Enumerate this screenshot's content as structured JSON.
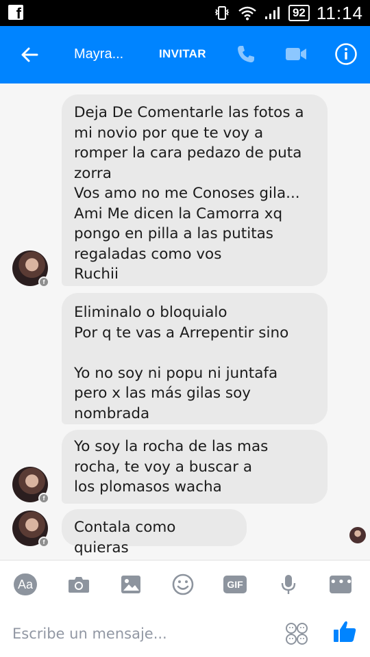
{
  "status_bar": {
    "battery": "92",
    "time": "11:14",
    "icons": [
      "facebook-app-icon",
      "vibrate-icon",
      "wifi-icon",
      "signal-icon",
      "battery-icon"
    ]
  },
  "header": {
    "contact_name": "Mayra...",
    "invite_label": "INVITAR",
    "icons": [
      "back-arrow-icon",
      "phone-icon",
      "video-icon",
      "info-icon"
    ]
  },
  "messages": [
    {
      "text": "Deja De Comentarle  las fotos a\nmi novio por que te voy a\nromper la cara pedazo de puta\nzorra\nVos amo no me Conoses gila...\nAmi Me dicen la Camorra xq\npongo en pilla a las putitas\nregaladas como vos\nRuchii"
    },
    {
      "text": "Eliminalo o bloquialo\nPor q te vas a Arrepentir sino\n\nYo no soy ni popu ni juntafa\npero x las más gilas soy\nnombrada"
    },
    {
      "text": "Yo soy la rocha de las mas\nrocha, te voy a buscar a\nlos plomasos wacha"
    },
    {
      "text": "Contala como quieras"
    }
  ],
  "composer": {
    "placeholder": "Escribe un mensaje...",
    "aa_label": "Aa",
    "gif_label": "GIF",
    "tools": [
      "text-style-icon",
      "camera-icon",
      "gallery-icon",
      "emoji-icon",
      "gif-icon",
      "microphone-icon",
      "more-icon",
      "stickers-icon",
      "like-icon"
    ]
  },
  "colors": {
    "accent": "#0084ff",
    "bubble": "#e9e9e9",
    "background": "#f6f6f6",
    "icon_gray": "#8d949e"
  }
}
